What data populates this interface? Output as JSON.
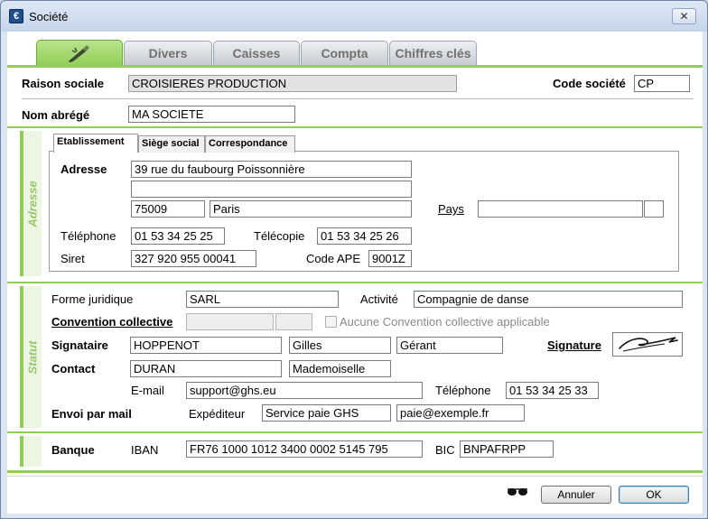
{
  "window": {
    "title": "Société",
    "close_glyph": "✕"
  },
  "tabs": [
    {
      "label": "",
      "icon": "pen-icon"
    },
    {
      "label": "Divers"
    },
    {
      "label": "Caisses"
    },
    {
      "label": "Compta"
    },
    {
      "label": "Chiffres clés"
    }
  ],
  "header": {
    "raison_sociale_label": "Raison sociale",
    "raison_sociale_value": "CROISIERES PRODUCTION",
    "code_societe_label": "Code société",
    "code_societe_value": "CP",
    "nom_abrege_label": "Nom abrégé",
    "nom_abrege_value": "MA SOCIETE"
  },
  "adresse": {
    "rail_label": "Adresse",
    "tabs": [
      "Etablissement",
      "Siège social",
      "Correspondance"
    ],
    "adresse_label": "Adresse",
    "line1": "39 rue du faubourg Poissonnière",
    "line2": "",
    "postal_code": "75009",
    "city": "Paris",
    "pays_label": "Pays",
    "pays_value": "",
    "pays_code": "",
    "telephone_label": "Téléphone",
    "telephone_value": "01 53 34 25 25",
    "telecopie_label": "Télécopie",
    "telecopie_value": "01 53 34 25 26",
    "siret_label": "Siret",
    "siret_value": "327 920 955 00041",
    "code_ape_label": "Code APE",
    "code_ape_value": "9001Z"
  },
  "statut": {
    "rail_label": "Statut",
    "forme_juridique_label": "Forme juridique",
    "forme_juridique_value": "SARL",
    "activite_label": "Activité",
    "activite_value": "Compagnie de danse",
    "convention_label": "Convention collective",
    "convention_value": "",
    "convention_code": "",
    "aucune_convention_label": "Aucune Convention collective applicable",
    "signataire_label": "Signataire",
    "signataire_nom": "HOPPENOT",
    "signataire_prenom": "Gilles",
    "signataire_fonction": "Gérant",
    "signature_label": "Signature",
    "contact_label": "Contact",
    "contact_nom": "DURAN",
    "contact_civilite": "Mademoiselle",
    "email_label": "E-mail",
    "email_value": "support@ghs.eu",
    "contact_tel_label": "Téléphone",
    "contact_tel_value": "01 53 34 25 33",
    "envoi_label": "Envoi par mail",
    "expediteur_label": "Expéditeur",
    "expediteur_value": "Service paie GHS",
    "expediteur_email": "paie@exemple.fr"
  },
  "banque": {
    "label": "Banque",
    "iban_label": "IBAN",
    "iban_value": "FR76 1000 1012 3400 0002 5145 795",
    "bic_label": "BIC",
    "bic_value": "BNPAFRPP"
  },
  "footer": {
    "cancel_label": "Annuler",
    "ok_label": "OK",
    "glasses_icon": "glasses-icon"
  }
}
